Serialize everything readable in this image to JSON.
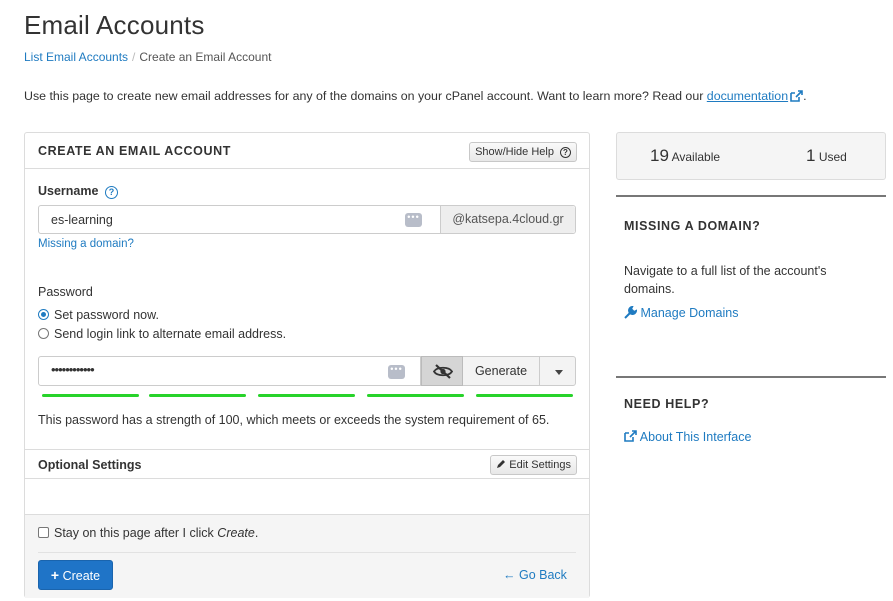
{
  "page": {
    "title": "Email Accounts",
    "breadcrumb": {
      "parent": "List Email Accounts",
      "separator": "/",
      "current": "Create an Email Account"
    },
    "intro": "Use this page to create new email addresses for any of the domains on your cPanel account. Want to learn more? Read our",
    "intro_link": "documentation",
    "intro_end": "."
  },
  "form": {
    "header": "CREATE AN EMAIL ACCOUNT",
    "help_button": "Show/Hide Help",
    "username_label": "Username",
    "username_value": "es-learning",
    "domain": "@katsepa.4cloud.gr",
    "missing_domain_link": "Missing a domain?",
    "password_label": "Password",
    "radio_options": [
      {
        "label": "Set password now.",
        "checked": true
      },
      {
        "label": "Send login link to alternate email address.",
        "checked": false
      }
    ],
    "password_value": "••••••••••••",
    "generate_button": "Generate",
    "strength_segments": 5,
    "strength_color": "#27d32a",
    "strength_text": "This password has a strength of 100, which meets or exceeds the system requirement of 65.",
    "optional_settings_label": "Optional Settings",
    "edit_settings_button": "Edit Settings",
    "stay_checkbox_prefix": "Stay on this page after I click",
    "stay_checkbox_em": "Create",
    "stay_checkbox_suffix": ".",
    "create_button": "Create",
    "go_back_link": "Go Back"
  },
  "sidebar": {
    "available_count": "19",
    "available_label": "Available",
    "used_count": "1",
    "used_label": "Used",
    "missing_domain_heading": "MISSING A DOMAIN?",
    "missing_domain_text": "Navigate to a full list of the account's domains.",
    "manage_domains_link": "Manage Domains",
    "need_help_heading": "NEED HELP?",
    "about_link": "About This Interface"
  },
  "colors": {
    "link": "#1f7bc1",
    "primary_button": "#1f74c7"
  }
}
